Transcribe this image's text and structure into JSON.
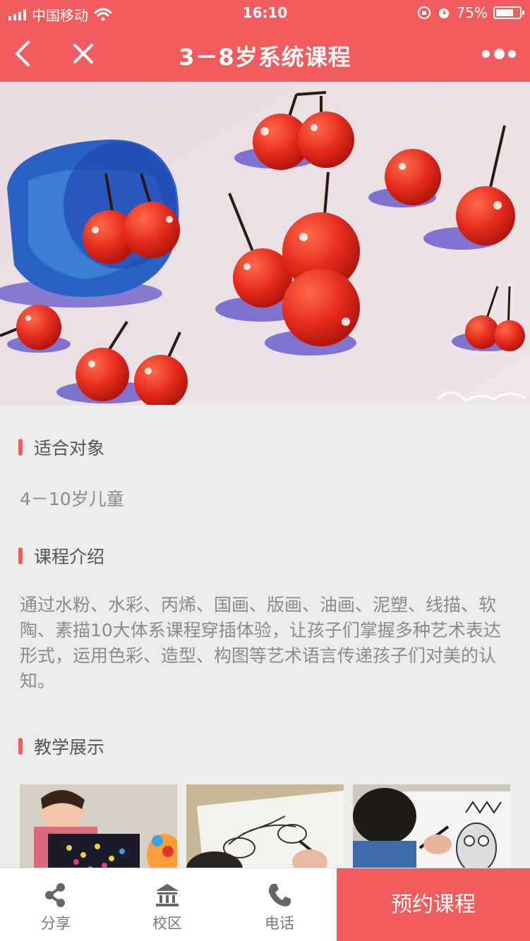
{
  "status_bar": {
    "carrier": "中国移动",
    "time": "16:10",
    "battery": "75%",
    "battery_level": 0.75
  },
  "nav": {
    "title": "3－8岁系统课程",
    "icons": [
      "back-icon",
      "close-icon",
      "more-icon"
    ]
  },
  "sections": {
    "audience": {
      "title": "适合对象",
      "text": "4－10岁儿童"
    },
    "intro": {
      "title": "课程介绍",
      "text": "通过水粉、水彩、丙烯、国画、版画、油画、泥塑、线描、软陶、素描10大体系课程穿插体验，让孩子们掌握多种艺术表达形式，运用色彩、造型、构图等艺术语言传递孩子们对美的认知。"
    },
    "showcase": {
      "title": "教学展示"
    }
  },
  "bottom_bar": {
    "share_label": "分享",
    "campus_label": "校区",
    "phone_label": "电话",
    "book_label": "预约课程"
  },
  "colors": {
    "accent": "#f25c5e",
    "background": "#ececea",
    "text_muted": "#8a8a8a"
  }
}
